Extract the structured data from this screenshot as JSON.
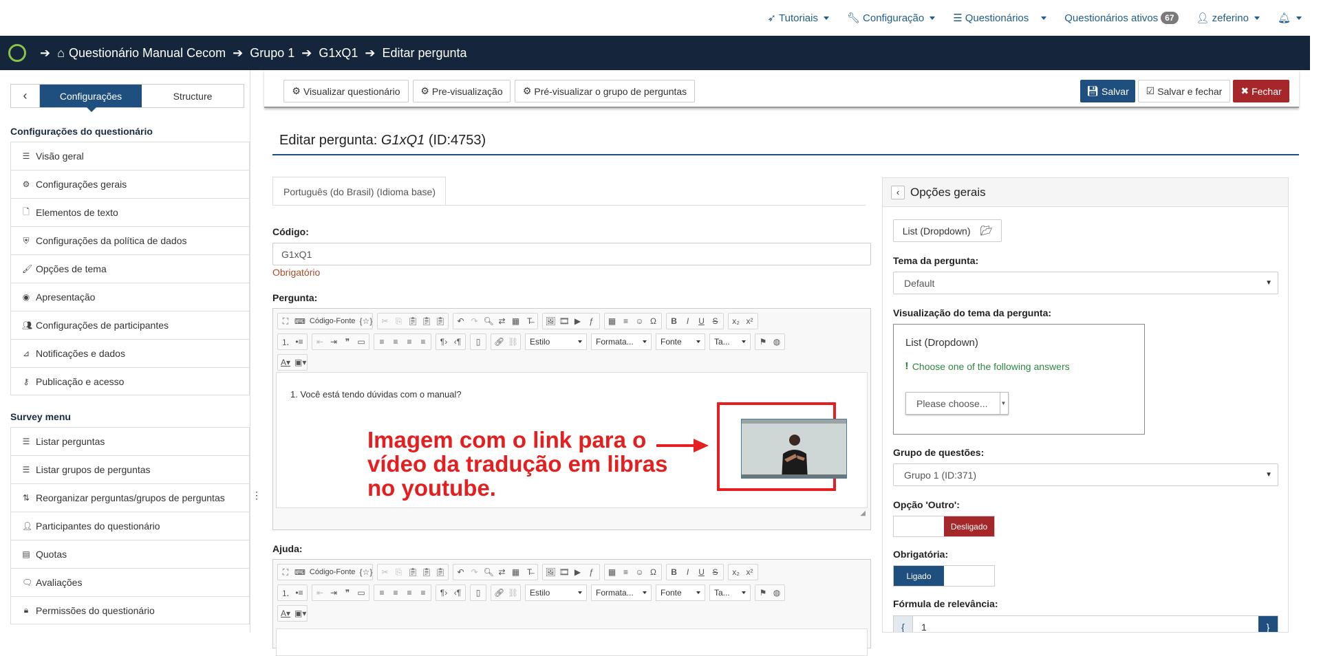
{
  "topnav": {
    "tutorials": "Tutoriais",
    "configuration": "Configuração",
    "surveys": "Questionários",
    "active_surveys": "Questionários ativos",
    "active_count": "67",
    "user": "zeferino"
  },
  "breadcrumb": {
    "survey": "Questionário Manual Cecom",
    "group": "Grupo 1",
    "question": "G1xQ1",
    "action": "Editar pergunta"
  },
  "sidebar": {
    "tab_settings": "Configurações",
    "tab_structure": "Structure",
    "settings_heading": "Configurações do questionário",
    "settings_items": [
      {
        "label": "Visão geral",
        "icon": "list-icon"
      },
      {
        "label": "Configurações gerais",
        "icon": "cogs-icon"
      },
      {
        "label": "Elementos de texto",
        "icon": "file-icon"
      },
      {
        "label": "Configurações da política de dados",
        "icon": "shield-icon"
      },
      {
        "label": "Opções de tema",
        "icon": "brush-icon"
      },
      {
        "label": "Apresentação",
        "icon": "eye-slash-icon"
      },
      {
        "label": "Configurações de participantes",
        "icon": "users-icon"
      },
      {
        "label": "Notificações e dados",
        "icon": "rss-icon"
      },
      {
        "label": "Publicação e acesso",
        "icon": "key-icon"
      }
    ],
    "menu_heading": "Survey menu",
    "menu_items": [
      {
        "label": "Listar perguntas",
        "icon": "list-icon"
      },
      {
        "label": "Listar grupos de perguntas",
        "icon": "list-icon"
      },
      {
        "label": "Reorganizar perguntas/grupos de perguntas",
        "icon": "reorder-icon"
      },
      {
        "label": "Participantes do questionário",
        "icon": "user-icon"
      },
      {
        "label": "Quotas",
        "icon": "tasks-icon"
      },
      {
        "label": "Avaliações",
        "icon": "comment-icon"
      },
      {
        "label": "Permissões do questionário",
        "icon": "lock-icon"
      }
    ]
  },
  "toolbar": {
    "view_survey": "Visualizar questionário",
    "preview": "Pre-visualização",
    "preview_group": "Pré-visualizar o grupo de perguntas",
    "save": "Salvar",
    "save_close": "Salvar e fechar",
    "close": "Fechar"
  },
  "page": {
    "title_prefix": "Editar pergunta:",
    "question_code": "G1xQ1",
    "question_id": "(ID:4753)",
    "language_tab": "Português (do Brasil) (Idioma base)",
    "code_label": "Código:",
    "code_value": "G1xQ1",
    "required_note": "Obrigatório",
    "question_label": "Pergunta:",
    "help_label": "Ajuda:",
    "question_text": "1. Você está tendo dúvidas com o manual?",
    "annotation": "Imagem com o link para o vídeo da tradução em libras no youtube."
  },
  "editor": {
    "source_label": "Código-Fonte",
    "style": "Estilo",
    "format": "Formata...",
    "font": "Fonte",
    "size": "Ta..."
  },
  "rpanel": {
    "title": "Opções gerais",
    "type_button": "List (Dropdown)",
    "theme_label": "Tema da pergunta:",
    "theme_value": "Default",
    "theme_preview_label": "Visualização do tema da pergunta:",
    "preview_title": "List (Dropdown)",
    "preview_hint": "Choose one of the following answers",
    "preview_select": "Please choose...",
    "group_label": "Grupo de questões:",
    "group_value": "Grupo 1 (ID:371)",
    "other_label": "Opção 'Outro':",
    "other_state": "Desligado",
    "mandatory_label": "Obrigatória:",
    "mandatory_state": "Ligado",
    "relevance_label": "Fórmula de relevância:",
    "relevance_value": "1"
  },
  "colors": {
    "brand_dark": "#14253c",
    "primary": "#1f4f7e",
    "danger": "#a6272a",
    "annotation_red": "#e51f1f"
  }
}
